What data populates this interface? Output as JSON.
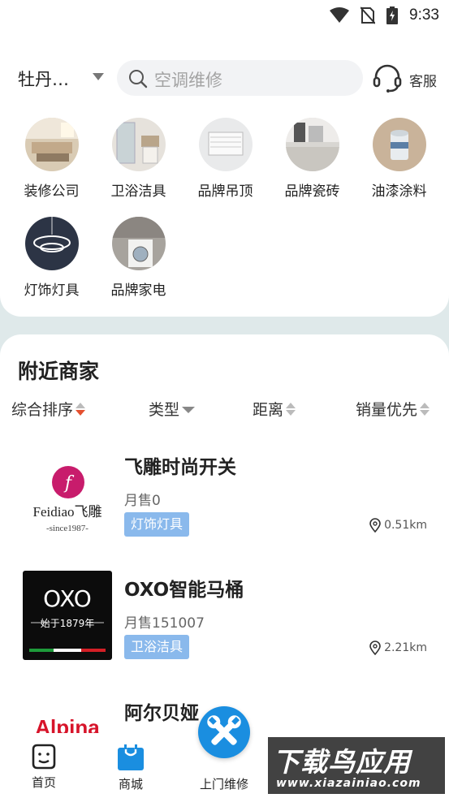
{
  "status_bar": {
    "time": "9:33"
  },
  "header": {
    "city": "牡丹…",
    "search_placeholder": "空调维修",
    "service_label": "客服"
  },
  "categories": [
    {
      "label": "装修公司",
      "icon": "living-room-photo"
    },
    {
      "label": "卫浴洁具",
      "icon": "bathroom-photo"
    },
    {
      "label": "品牌吊顶",
      "icon": "ceiling-photo"
    },
    {
      "label": "品牌瓷砖",
      "icon": "tile-photo"
    },
    {
      "label": "油漆涂料",
      "icon": "paint-bucket-photo"
    },
    {
      "label": "灯饰灯具",
      "icon": "chandelier-photo"
    },
    {
      "label": "品牌家电",
      "icon": "washer-photo"
    }
  ],
  "nearby": {
    "title": "附近商家",
    "sort": [
      {
        "label": "综合排序"
      },
      {
        "label": "类型"
      },
      {
        "label": "距离"
      },
      {
        "label": "销量优先"
      }
    ],
    "shops": [
      {
        "name": "飞雕时尚开关",
        "sales": "月售0",
        "tag": "灯饰灯具",
        "distance": "0.51km",
        "logo_text": "Feidiao飞雕",
        "logo_sub": "-since1987-"
      },
      {
        "name": "OXO智能马桶",
        "sales": "月售151007",
        "tag": "卫浴洁具",
        "distance": "2.21km",
        "logo_text": "OXO",
        "logo_sub": "始于1879年"
      },
      {
        "name": "阿尔贝娅",
        "logo_text": "Alpina"
      }
    ]
  },
  "tabs": [
    {
      "label": "首页",
      "icon": "home-face-icon"
    },
    {
      "label": "商城",
      "icon": "shopping-bag-icon"
    },
    {
      "label": "上门维修",
      "icon": "wrench-screwdriver-icon"
    }
  ],
  "watermark": {
    "title": "下载鸟应用",
    "url": "www.xiazainiao.com"
  },
  "colors": {
    "accent_blue": "#1a8ee0",
    "tag_blue": "#8ab9ec",
    "sort_active": "#e4502f",
    "page_bg": "#dfe9ea"
  }
}
